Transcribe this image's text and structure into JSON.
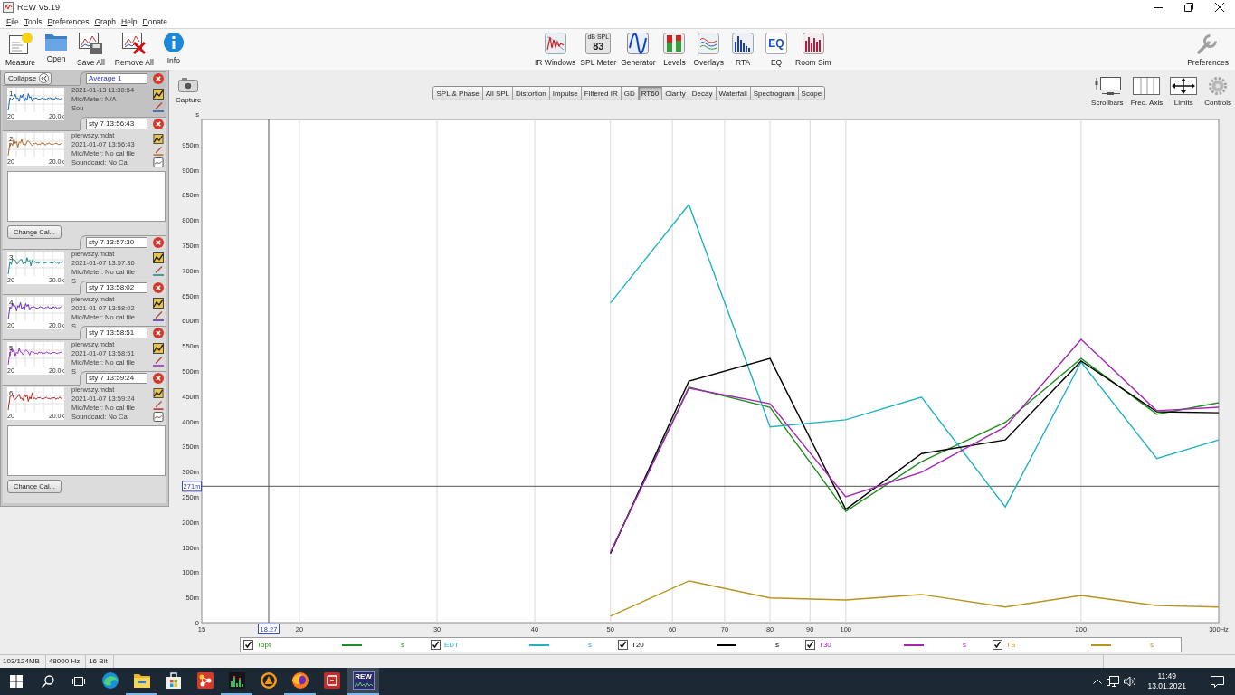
{
  "window": {
    "title": "REW V5.19"
  },
  "menu": [
    "File",
    "Tools",
    "Preferences",
    "Graph",
    "Help",
    "Donate"
  ],
  "toolbar": {
    "left": [
      {
        "kind": "measure",
        "label": "Measure"
      },
      {
        "kind": "open",
        "label": "Open"
      },
      {
        "kind": "save_all",
        "label": "Save All"
      },
      {
        "kind": "remove_all",
        "label": "Remove All"
      },
      {
        "kind": "info",
        "label": "Info"
      }
    ],
    "center": [
      {
        "kind": "ir_windows",
        "label": "IR Windows"
      },
      {
        "kind": "spl_meter",
        "label": "SPL Meter",
        "icon_caption": "dB SPL",
        "icon_value": "83"
      },
      {
        "kind": "generator",
        "label": "Generator"
      },
      {
        "kind": "levels",
        "label": "Levels"
      },
      {
        "kind": "overlays",
        "label": "Overlays"
      },
      {
        "kind": "rta",
        "label": "RTA"
      },
      {
        "kind": "eq",
        "label": "EQ",
        "icon_text": "EQ"
      },
      {
        "kind": "room_sim",
        "label": "Room Sim"
      }
    ],
    "right": [
      {
        "kind": "preferences",
        "label": "Preferences"
      }
    ]
  },
  "measurements": {
    "collapse": "Collapse",
    "items": [
      {
        "number": "1",
        "name": "Average 1",
        "selected": true,
        "expanded": false,
        "color": "#1f63b0",
        "lines": [
          "2021-01-13 11:30:54",
          "Mic/Meter: N/A",
          "Sou"
        ],
        "axis": [
          "20",
          "20.0k"
        ]
      },
      {
        "number": "2",
        "name": "sty 7 13:56:43",
        "selected": false,
        "expanded": true,
        "color": "#b0662a",
        "lines": [
          "pierwszy.mdat",
          "2021-01-07 13:56:43",
          "Mic/Meter: No cal file",
          "Soundcard: No Cal"
        ],
        "axis": [
          "20",
          "20.0k"
        ],
        "button": "Change Cal..."
      },
      {
        "number": "3",
        "name": "sty 7 13:57:30",
        "selected": false,
        "expanded": false,
        "color": "#1f8a8a",
        "lines": [
          "pierwszy.mdat",
          "2021-01-07 13:57:30",
          "Mic/Meter: No cal file",
          "S"
        ],
        "axis": [
          "20",
          "20.0k"
        ]
      },
      {
        "number": "4",
        "name": "sty 7 13:58:02",
        "selected": false,
        "expanded": false,
        "color": "#6a2ec0",
        "lines": [
          "pierwszy.mdat",
          "2021-01-07 13:58:02",
          "Mic/Meter: No cal file",
          "S"
        ],
        "axis": [
          "20",
          "20.0k"
        ]
      },
      {
        "number": "5",
        "name": "sty 7 13:58:51",
        "selected": false,
        "expanded": false,
        "color": "#a030c8",
        "lines": [
          "pierwszy.mdat",
          "2021-01-07 13:58:51",
          "Mic/Meter: No cal file",
          "S"
        ],
        "axis": [
          "20",
          "20.0k"
        ]
      },
      {
        "number": "6",
        "name": "sty 7 13:59:24",
        "selected": false,
        "expanded": true,
        "color": "#b02828",
        "lines": [
          "pierwszy.mdat",
          "2021-01-07 13:59:24",
          "Mic/Meter: No cal file",
          "Soundcard: No Cal"
        ],
        "axis": [
          "20",
          "20.0k"
        ],
        "button": "Change Cal..."
      }
    ]
  },
  "graph": {
    "capture": "Capture",
    "tabs": [
      {
        "label": "SPL & Phase",
        "selected": false
      },
      {
        "label": "All SPL",
        "selected": false
      },
      {
        "label": "Distortion",
        "selected": false
      },
      {
        "label": "Impulse",
        "selected": false
      },
      {
        "label": "Filtered IR",
        "selected": false
      },
      {
        "label": "GD",
        "selected": false
      },
      {
        "label": "RT60",
        "selected": true
      },
      {
        "label": "Clarity",
        "selected": false
      },
      {
        "label": "Decay",
        "selected": false
      },
      {
        "label": "Waterfall",
        "selected": false
      },
      {
        "label": "Spectrogram",
        "selected": false
      },
      {
        "label": "Scope",
        "selected": false
      }
    ],
    "tools": [
      {
        "kind": "scrollbars",
        "label": "Scrollbars"
      },
      {
        "kind": "freq_axis",
        "label": "Freq. Axis"
      },
      {
        "kind": "limits",
        "label": "Limits"
      },
      {
        "kind": "controls",
        "label": "Controls"
      }
    ],
    "chart_data": {
      "type": "line",
      "ylabel": "s",
      "log": "x",
      "grid": true,
      "x": [
        50,
        63,
        80,
        100,
        125,
        160,
        200,
        250,
        300
      ],
      "series": [
        {
          "name": "Topt",
          "color": "#1f8f1f",
          "values": [
            140,
            468,
            428,
            221,
            320,
            398,
            525,
            414,
            437
          ]
        },
        {
          "name": "EDT",
          "color": "#20b2c2",
          "values": [
            635,
            831,
            389,
            403,
            448,
            230,
            518,
            326,
            363
          ]
        },
        {
          "name": "T20",
          "color": "#000000",
          "values": [
            137,
            480,
            525,
            225,
            336,
            363,
            520,
            419,
            417
          ]
        },
        {
          "name": "T30",
          "color": "#a526b5",
          "values": [
            140,
            466,
            435,
            250,
            299,
            389,
            563,
            421,
            428
          ]
        },
        {
          "name": "TS",
          "color": "#b8931f",
          "values": [
            13,
            83,
            49,
            45,
            56,
            31,
            54,
            34,
            31
          ]
        }
      ],
      "xlim": [
        15,
        300
      ],
      "ylim": [
        0,
        1000
      ],
      "xticks": [
        15,
        20,
        30,
        40,
        50,
        60,
        70,
        80,
        90,
        100,
        200,
        {
          "value": 300,
          "label": "300Hz"
        }
      ],
      "yticks": [
        0,
        {
          "value": 50,
          "label": "50m"
        },
        {
          "value": 100,
          "label": "100m"
        },
        {
          "value": 150,
          "label": "150m"
        },
        {
          "value": 200,
          "label": "200m"
        },
        {
          "value": 250,
          "label": "250m"
        },
        {
          "value": 300,
          "label": "300m"
        },
        {
          "value": 350,
          "label": "350m"
        },
        {
          "value": 400,
          "label": "400m"
        },
        {
          "value": 450,
          "label": "450m"
        },
        {
          "value": 500,
          "label": "500m"
        },
        {
          "value": 550,
          "label": "550m"
        },
        {
          "value": 600,
          "label": "600m"
        },
        {
          "value": 650,
          "label": "650m"
        },
        {
          "value": 700,
          "label": "700m"
        },
        {
          "value": 750,
          "label": "750m"
        },
        {
          "value": 800,
          "label": "800m"
        },
        {
          "value": 850,
          "label": "850m"
        },
        {
          "value": 900,
          "label": "900m"
        },
        {
          "value": 950,
          "label": "950m"
        }
      ],
      "ref_lines": [
        {
          "axis": "x",
          "value": 18.27,
          "label": "18.27"
        },
        {
          "axis": "y",
          "value": 271,
          "label": "271m"
        }
      ]
    },
    "legend": [
      {
        "checked": true,
        "unit": "s"
      },
      {
        "checked": true,
        "unit": "s"
      },
      {
        "checked": true,
        "unit": "s"
      },
      {
        "checked": true,
        "unit": "s"
      },
      {
        "checked": true,
        "unit": "s"
      }
    ]
  },
  "status_bar": [
    "103/124MB",
    "48000 Hz",
    "16 Bit"
  ],
  "taskbar": {
    "system": [
      {
        "kind": "start"
      },
      {
        "kind": "search"
      },
      {
        "kind": "task_view"
      }
    ],
    "apps": [
      {
        "kind": "edge",
        "running": false,
        "selected": false
      },
      {
        "kind": "explorer",
        "running": true,
        "selected": false
      },
      {
        "kind": "store",
        "running": false,
        "selected": false
      },
      {
        "kind": "nodes",
        "running": false,
        "selected": false
      },
      {
        "kind": "equalizer",
        "running": true,
        "selected": false
      },
      {
        "kind": "aimp",
        "running": false,
        "selected": false
      },
      {
        "kind": "firefox",
        "running": true,
        "selected": false
      },
      {
        "kind": "red_tile",
        "running": false,
        "selected": false
      },
      {
        "kind": "rew",
        "running": true,
        "selected": true,
        "label": "REW"
      }
    ],
    "tray": {
      "time": "11:49",
      "date": "13.01.2021"
    }
  }
}
